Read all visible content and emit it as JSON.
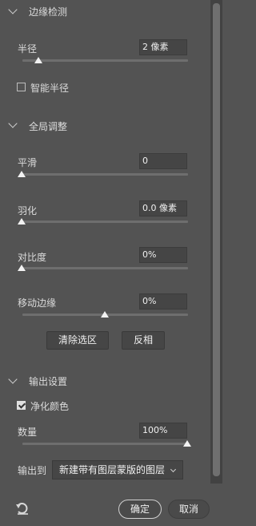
{
  "edge_detection": {
    "title": "边缘检测",
    "radius": {
      "label": "半径",
      "value": "2 像素",
      "slider_level": 0.17
    },
    "smart_radius": {
      "label": "智能半径",
      "checked": false
    }
  },
  "global_adjust": {
    "title": "全局调整",
    "smooth": {
      "label": "平滑",
      "value": "0",
      "slider_level": 0.0
    },
    "feather": {
      "label": "羽化",
      "value": "0.0 像素",
      "slider_level": 0.0
    },
    "contrast": {
      "label": "对比度",
      "value": "0%",
      "slider_level": 0.0
    },
    "shift_edge": {
      "label": "移动边缘",
      "value": "0%",
      "slider_level": 0.5
    },
    "clear_selection_label": "清除选区",
    "invert_label": "反相"
  },
  "output": {
    "title": "输出设置",
    "decontaminate": {
      "label": "净化颜色",
      "checked": true
    },
    "amount": {
      "label": "数量",
      "value": "100%",
      "slider_level": 1.0
    },
    "output_to": {
      "label": "输出到",
      "value": "新建带有图层蒙版的图层"
    }
  },
  "footer": {
    "reset_icon": "reset-icon",
    "ok_label": "确定",
    "cancel_label": "取消"
  }
}
